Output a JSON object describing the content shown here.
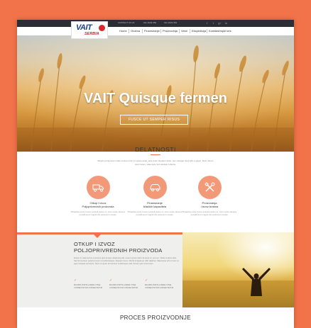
{
  "topbar": {
    "contact_1": "CONTACT US 24",
    "contact_2": "011 3029 350",
    "contact_3": "011 3029 352",
    "social_icons": [
      "facebook-icon",
      "twitter-icon",
      "google-plus-icon",
      "linkedin-icon"
    ],
    "social_glyphs": [
      "f",
      "t",
      "g+",
      "in"
    ]
  },
  "logo": {
    "word": "VAIT",
    "sub": "SERBIA"
  },
  "nav": {
    "items": [
      "Home",
      "Onama",
      "Finansiranje",
      "Proizvodnja",
      "Vesti",
      "Ekspedicija",
      "Kontakti/mple kes"
    ]
  },
  "hero": {
    "title": "VAIT Quisque fermen",
    "button": "FUSCE UT SEMPER RISUS"
  },
  "delatnosti": {
    "title": "DELATNOSTI",
    "intro": "Mauris porta lorem vitae cursus tortor in neque amet, ante ante interdum dolor, nec volutpat risus felis a quam. Duis rutrum nunc lorem, vitae quis nisl volutpat, lobortis.",
    "services": [
      {
        "icon": "truck-icon",
        "title_1": "Otkup i izvoz",
        "title_2": "Poljoprivrednih proizvoda",
        "text": "Phasellus porta. Fusce suscipit varius mi. Cum sociis natoque penatibus et magnis dis parturient montes."
      },
      {
        "icon": "car-icon",
        "title_1": "Finansiranje",
        "title_2": "lidačkih kapacitela",
        "text": "Phasellus porta. Fusce suscipit varius mi. Cum sociis natoque penatibus et magnis dis parturient montes."
      },
      {
        "icon": "tools-icon",
        "title_1": "Proizvodnja",
        "title_2": "i izvoz brašna",
        "text": "Phasellus porta. Fusce suscipit varius mi. Cum sociis natoque penatibus et magnis dis parturient montes."
      }
    ]
  },
  "otkup": {
    "title_1": "OTKUP I IZVOZ",
    "title_2": "POLJOPRIVREDNIH PROIZVODA",
    "text": "Donec in vitae lectus a tempus quis tempor adipiscing elit. Lorem ipsum dolor sit amet ut, est nec. Nulla ut lacus felis. Sed fermentum pulvinar lorem ut pellentesque. Aliquam lorem. Morbi id ligula ac nibh dapibus. Maecenas elit ut nunc ut eget volutpat est turpis. Nunc ut quam fermentum scelerisque velit. Donec quis urna lorem.",
    "features": [
      "MAURIS PORTA LOREM VITAE CONSECTETUR CONSECTETUR",
      "MAURIS PORTA LOREM VITAE CONSECTETUR CONSECTETUR",
      "MAURIS PORTA LOREM VITAE CONSECTETUR CONSECTETUR"
    ]
  },
  "proces": {
    "title": "PROCES PROIZVODNJE"
  },
  "colors": {
    "accent": "#f2734a",
    "brand_blue": "#1d3f8f",
    "brand_red": "#d7262c",
    "topbar": "#2c2e36"
  }
}
